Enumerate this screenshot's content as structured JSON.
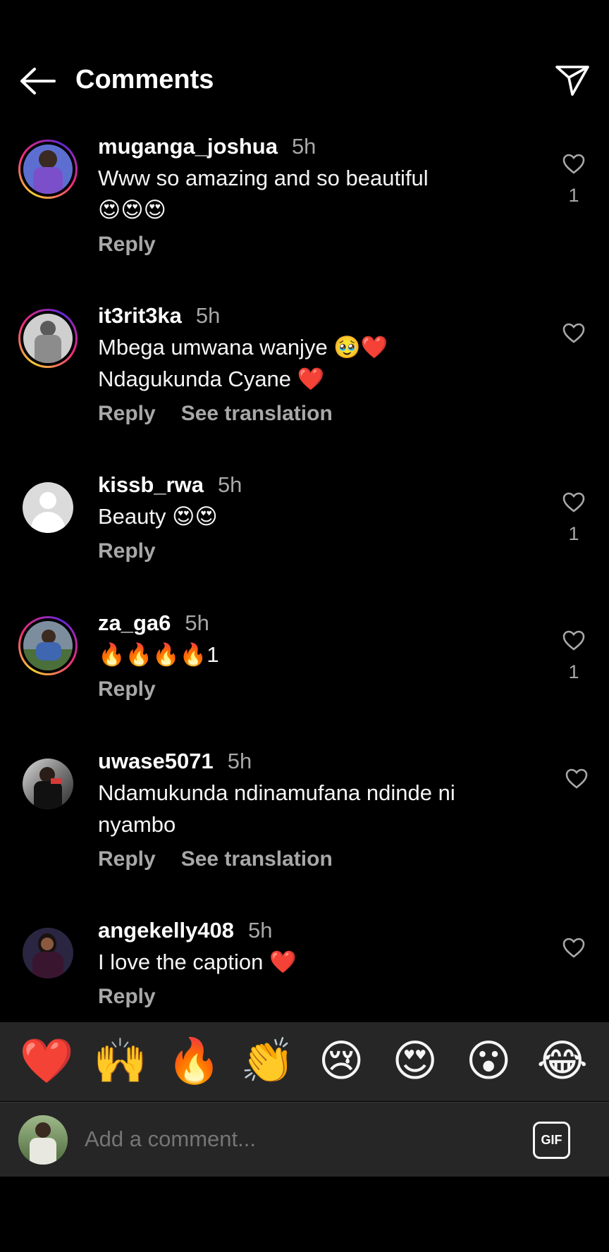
{
  "header": {
    "title": "Comments",
    "back_icon": "arrow-left-icon",
    "share_icon": "paper-plane-icon"
  },
  "comments": [
    {
      "username": "muganga_joshua",
      "time": "5h",
      "line1": "Www so amazing and so beautiful",
      "line2": "😍😍😍",
      "reply": "Reply",
      "translate": "",
      "likes": "1"
    },
    {
      "username": "it3rit3ka",
      "time": "5h",
      "line1": "Mbega umwana wanjye 🥹❤️",
      "line2": "Ndagukunda Cyane ❤️",
      "reply": "Reply",
      "translate": "See translation",
      "likes": ""
    },
    {
      "username": "kissb_rwa",
      "time": "5h",
      "line1": "Beauty 😍😍",
      "line2": "",
      "reply": "Reply",
      "translate": "",
      "likes": "1"
    },
    {
      "username": "za_ga6",
      "time": "5h",
      "line1": "🔥🔥🔥🔥1",
      "line2": "",
      "reply": "Reply",
      "translate": "",
      "likes": "1"
    },
    {
      "username": "uwase5071",
      "time": "5h",
      "line1": "Ndamukunda ndinamufana ndinde ni",
      "line2": "nyambo",
      "reply": "Reply",
      "translate": "See translation",
      "likes": ""
    },
    {
      "username": "angekelly408",
      "time": "5h",
      "line1": "I love the caption ❤️",
      "line2": "",
      "reply": "Reply",
      "translate": "",
      "likes": ""
    }
  ],
  "emoji_bar": [
    "❤️",
    "🙌",
    "🔥",
    "👏",
    "😢",
    "😍",
    "😮",
    "😂"
  ],
  "compose": {
    "placeholder": "Add a comment...",
    "gif_label": "GIF"
  },
  "colors": {
    "background": "#000000",
    "panel": "#262626",
    "muted_text": "#a8a8a8",
    "story_ring": "#ee2a7b"
  }
}
